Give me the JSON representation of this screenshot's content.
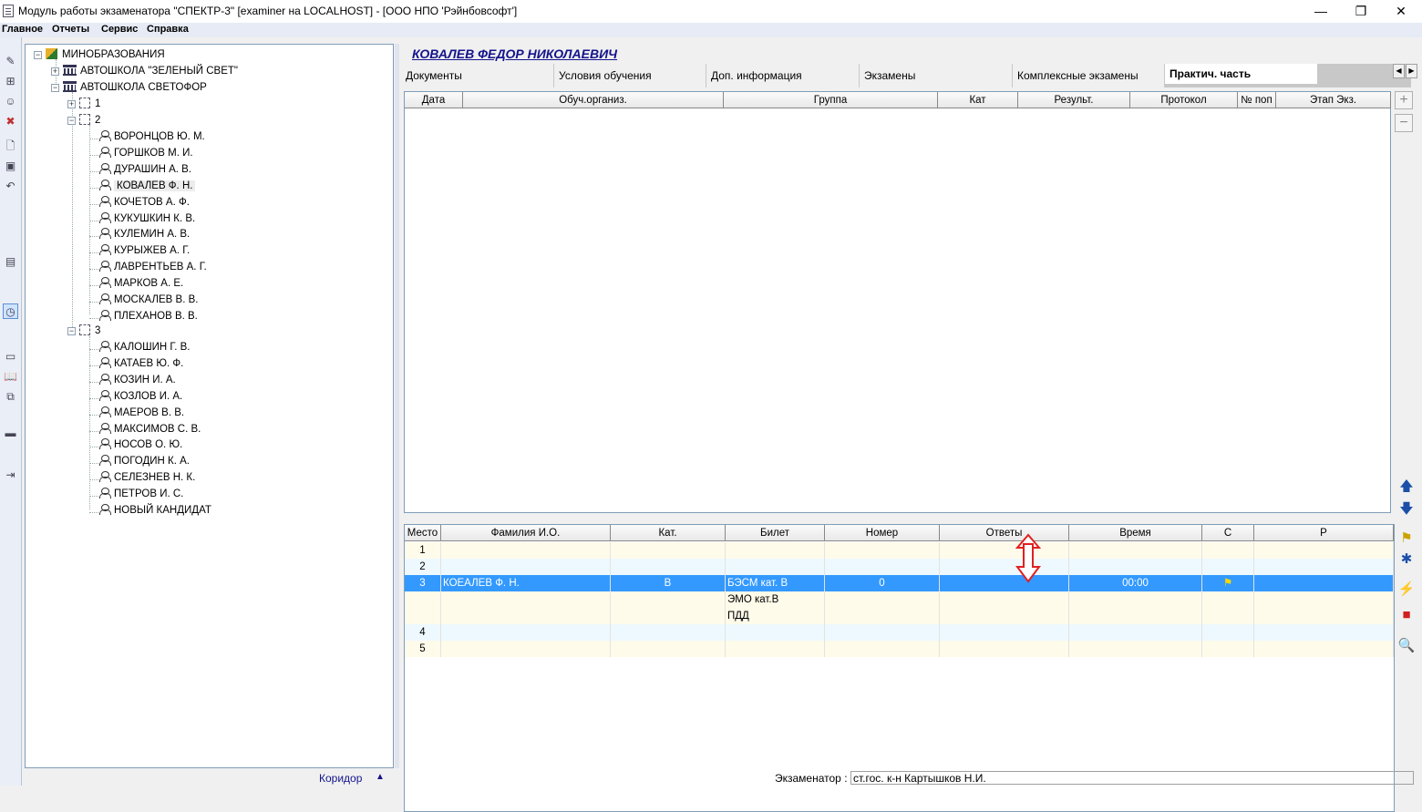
{
  "window": {
    "title": "Модуль работы экзаменатора \"СПЕКТР-3\" [examiner на LOCALHOST] - [ООО НПО 'Рэйнбовсофт']",
    "controls": {
      "minimize": "—",
      "restore": "❐",
      "close": "✕"
    }
  },
  "menu": [
    "Главное",
    "Отчеты",
    "Сервис",
    "Справка"
  ],
  "tree": {
    "root": "МИНОБРАЗОВАНИЯ",
    "school1": "АВТОШКОЛА \"ЗЕЛЕНЫЙ СВЕТ\"",
    "school2": "АВТОШКОЛА СВЕТОФОР",
    "group1": "1",
    "group2": "2",
    "group2_members": [
      "ВОРОНЦОВ Ю. М.",
      "ГОРШКОВ М. И.",
      "ДУРАШИН А. В.",
      "КОВАЛЕВ Ф. Н.",
      "КОЧЕТОВ А. Ф.",
      "КУКУШКИН К. В.",
      "КУЛЕМИН А. В.",
      "КУРЫЖЕВ А. Г.",
      "ЛАВРЕНТЬЕВ А. Г.",
      "МАРКОВ А. Е.",
      "МОСКАЛЕВ В. В.",
      "ПЛЕХАНОВ В. В."
    ],
    "group3": "3",
    "group3_members": [
      "КАЛОШИН Г. В.",
      "КАТАЕВ Ю. Ф.",
      "КОЗИН И. А.",
      "КОЗЛОВ И. А.",
      "МАЕРОВ В. В.",
      "МАКСИМОВ С. В.",
      "НОСОВ О. Ю.",
      "ПОГОДИН К. А.",
      "СЕЛЕЗНЕВ Н. К.",
      "ПЕТРОВ И. С.",
      "НОВЫЙ КАНДИДАТ"
    ],
    "footer": "Коридор"
  },
  "student": {
    "name": "КОВАЛЕВ ФЕДОР НИКОЛАЕВИЧ"
  },
  "tabs": [
    "Документы",
    "Условия обучения",
    "Доп. информация",
    "Экзамены",
    "Комплексные экзамены",
    "Практич. часть"
  ],
  "grid1": {
    "headers": [
      "Дата",
      "Обуч.организ.",
      "Группа",
      "Кат",
      "Результ.",
      "Протокол",
      "№ поп",
      "Этап Экз."
    ]
  },
  "grid2": {
    "headers": [
      "Место",
      "Фамилия И.О.",
      "Кат.",
      "Билет",
      "Номер",
      "Ответы",
      "Время",
      "С",
      "Р"
    ],
    "rows": [
      {
        "place": "1",
        "name": "",
        "cat": "",
        "ticket": "",
        "number": "",
        "answers": "",
        "time": ""
      },
      {
        "place": "2",
        "name": "",
        "cat": "",
        "ticket": "",
        "number": "",
        "answers": "",
        "time": ""
      },
      {
        "place": "3",
        "name": "КОЕАЛЕВ Ф. Н.",
        "cat": "B",
        "ticket": "БЭСМ кат. В",
        "number": "0",
        "answers": "",
        "time": "00:00"
      },
      {
        "place": "",
        "name": "",
        "cat": "",
        "ticket": "ЭМО кат.В",
        "number": "",
        "answers": "",
        "time": ""
      },
      {
        "place": "",
        "name": "",
        "cat": "",
        "ticket": "ПДД",
        "number": "",
        "answers": "",
        "time": ""
      },
      {
        "place": "4",
        "name": "",
        "cat": "",
        "ticket": "",
        "number": "",
        "answers": "",
        "time": ""
      },
      {
        "place": "5",
        "name": "",
        "cat": "",
        "ticket": "",
        "number": "",
        "answers": "",
        "time": ""
      }
    ]
  },
  "status": {
    "examiner_label": "Экзаменатор :",
    "examiner_value": "ст.гос. к-н Картышков Н.И."
  },
  "colors": {
    "selection": "#3399ff",
    "row_yellow": "#fffbea",
    "row_blue": "#eef9ff",
    "annotation": "#e02020",
    "name_link": "#14148c"
  }
}
